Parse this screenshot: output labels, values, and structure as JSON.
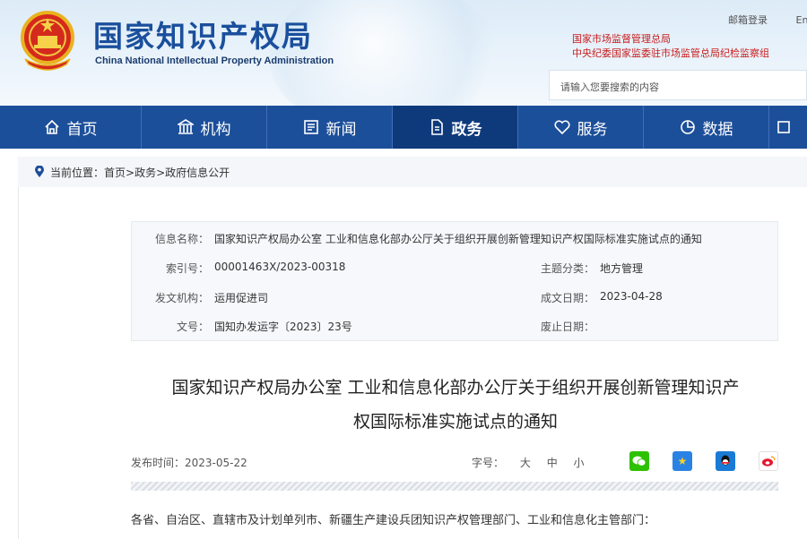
{
  "header": {
    "site_title": "国家知识产权局",
    "site_subtitle": "China National Intellectual Property Administration",
    "top_links": [
      "邮箱登录",
      "En"
    ],
    "red_links": [
      "国家市场监督管理总局",
      "中央纪委国家监委驻市场监管总局纪检监察组"
    ],
    "search_placeholder": "请输入您要搜索的内容"
  },
  "nav": {
    "items": [
      {
        "label": "首页",
        "icon": "home-icon"
      },
      {
        "label": "机构",
        "icon": "building-icon"
      },
      {
        "label": "新闻",
        "icon": "news-icon"
      },
      {
        "label": "政务",
        "icon": "document-icon"
      },
      {
        "label": "服务",
        "icon": "heart-icon"
      },
      {
        "label": "数据",
        "icon": "pie-chart-icon"
      }
    ],
    "active": "政务"
  },
  "breadcrumb": {
    "prefix": "当前位置：",
    "path": "首页>政务>政府信息公开"
  },
  "info": {
    "name_label": "信息名称：",
    "name_value": "国家知识产权局办公室 工业和信息化部办公厅关于组织开展创新管理知识产权国际标准实施试点的通知",
    "index_label": "索引号：",
    "index_value": "00001463X/2023-00318",
    "topic_label": "主题分类：",
    "topic_value": "地方管理",
    "org_label": "发文机构：",
    "org_value": "运用促进司",
    "date_label": "成文日期：",
    "date_value": "2023-04-28",
    "doc_label": "文号：",
    "doc_value": "国知办发运字〔2023〕23号",
    "expire_label": "废止日期：",
    "expire_value": ""
  },
  "article": {
    "title_line1": "国家知识产权局办公室 工业和信息化部办公厅关于组织开展创新管理知识产",
    "title_line2": "权国际标准实施试点的通知",
    "publish_time": "发布时间：2023-05-22",
    "font_size_label": "字号：",
    "font_sizes": [
      "大",
      "中",
      "小"
    ],
    "body_first_line": "各省、自治区、直辖市及计划单列市、新疆生产建设兵团知识产权管理部门、工业和信息化主管部门："
  },
  "share": {
    "buttons": [
      "wechat-icon",
      "qzone-icon",
      "qq-icon",
      "weibo-icon"
    ]
  },
  "colors": {
    "nav_bg": "#1c4f9a",
    "nav_active": "#0e3a7c",
    "title_blue": "#1a4f9c",
    "red_link": "#c81e1e"
  }
}
